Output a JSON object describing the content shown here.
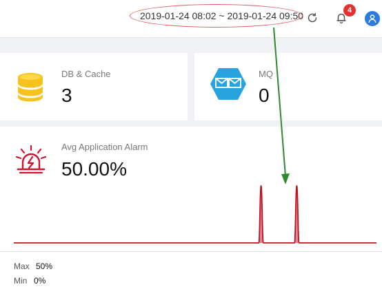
{
  "header": {
    "date_range": "2019-01-24 08:02 ~ 2019-01-24 09:50",
    "notification_count": "4"
  },
  "cards": [
    {
      "label": "DB & Cache",
      "value": "3",
      "icon": "database-icon"
    },
    {
      "label": "MQ",
      "value": "0",
      "icon": "message-queue-icon"
    }
  ],
  "alarm": {
    "label": "Avg Application Alarm",
    "value": "50.00%",
    "icon": "alarm-icon",
    "max_label": "Max",
    "max_value": "50%",
    "min_label": "Min",
    "min_value": "0%"
  },
  "colors": {
    "alarm_red": "#d0122c",
    "spike_fill": "#d98a95",
    "accent_blue": "#2b7be0",
    "badge_red": "#e8302f",
    "annotation_green": "#2f8a2f",
    "database_yellow": "#f6c21b"
  },
  "chart_data": {
    "type": "line",
    "series": [
      {
        "values": [
          0,
          0,
          0,
          0,
          0,
          0,
          0,
          0,
          0,
          0,
          0,
          0,
          0,
          0,
          0,
          0,
          0,
          0,
          0,
          0,
          0,
          0,
          0,
          0,
          0,
          0,
          0,
          0,
          0,
          0,
          0,
          0,
          0,
          0,
          0,
          0,
          0,
          0,
          0,
          0,
          0,
          0,
          0,
          0,
          0,
          0,
          0,
          0,
          0,
          0,
          0,
          0,
          0,
          0,
          0,
          0,
          0,
          0,
          0,
          0,
          0,
          0,
          0,
          0,
          0,
          0,
          0,
          0,
          0,
          0,
          0,
          0,
          0,
          0,
          0,
          0,
          0,
          0,
          0,
          0,
          0,
          0,
          0,
          0,
          0,
          0,
          0,
          0,
          0,
          0,
          50,
          0,
          0,
          0,
          0,
          0,
          0,
          0,
          0,
          0,
          0,
          0,
          0,
          50,
          0,
          0,
          0,
          0,
          0,
          0,
          0,
          0,
          0,
          0,
          0,
          0,
          0,
          0,
          0,
          0,
          0,
          0,
          0,
          0,
          0,
          0,
          0,
          0,
          0,
          0,
          0,
          0,
          0
        ]
      }
    ],
    "ylim": [
      0,
      50
    ]
  }
}
